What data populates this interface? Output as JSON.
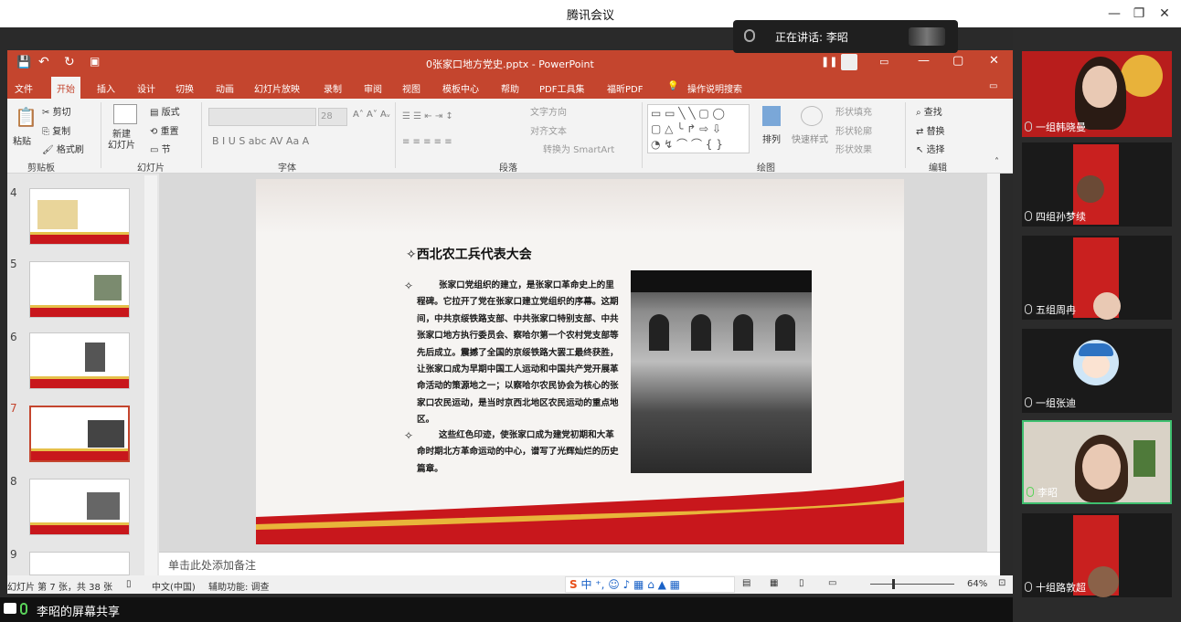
{
  "meeting": {
    "app_title": "腾讯会议",
    "speaking_label": "正在讲话: 李昭",
    "share_status": "李昭的屏幕共享"
  },
  "ppt": {
    "title": "0张家口地方党史.pptx - PowerPoint",
    "tabs": [
      "文件",
      "开始",
      "插入",
      "设计",
      "切换",
      "动画",
      "幻灯片放映",
      "录制",
      "审阅",
      "视图",
      "模板中心",
      "帮助",
      "PDF工具集",
      "福昕PDF"
    ],
    "search": "操作说明搜索",
    "ribbon": {
      "paste": "粘贴",
      "cut": "剪切",
      "copy": "复制",
      "format_painter": "格式刷",
      "new_slide": "新建\n幻灯片",
      "layout": "版式",
      "reset": "重置",
      "section": "节",
      "font_size": "28",
      "text_direction": "文字方向",
      "align_text": "对齐文本",
      "smartart": "转换为 SmartArt",
      "arrange": "排列",
      "quick_styles": "快速样式",
      "shape_fill": "形状填充",
      "shape_outline": "形状轮廓",
      "shape_effects": "形状效果",
      "find": "查找",
      "replace": "替换",
      "select": "选择",
      "groups": [
        "剪贴板",
        "幻灯片",
        "字体",
        "段落",
        "绘图",
        "编辑"
      ]
    },
    "thumbnails": [
      "4",
      "5",
      "6",
      "7",
      "8",
      "9"
    ],
    "selected_slide": "7",
    "slide": {
      "title": "✧西北农工兵代表大会",
      "bullet": "✧",
      "para1": "张家口党组织的建立，是张家口革命史上的里程碑。它拉开了党在张家口建立党组织的序幕。这期间，中共京绥铁路支部、中共张家口特别支部、中共张家口地方执行委员会、察哈尔第一个农村党支部等先后成立。震撼了全国的京绥铁路大罢工最终获胜，让张家口成为早期中国工人运动和中国共产党开展革命活动的策源地之一；以察哈尔农民协会为核心的张家口农民运动，是当时京西北地区农民运动的重点地区。",
      "para2": "这些红色印迹，使张家口成为建党初期和大革命时期北方革命运动的中心，谱写了光辉灿烂的历史篇章。"
    },
    "notes_placeholder": "单击此处添加备注",
    "status": {
      "slide_count": "幻灯片 第 7 张，共 38 张",
      "language": "中文(中国)",
      "accessibility": "辅助功能: 调查",
      "zoom": "64%"
    }
  },
  "participants": [
    {
      "name": "一组韩晓曼",
      "muted": true
    },
    {
      "name": "四组孙梦续",
      "muted": true
    },
    {
      "name": "五组周冉",
      "muted": true
    },
    {
      "name": "一组张迪",
      "muted": true
    },
    {
      "name": "李昭",
      "muted": false
    },
    {
      "name": "十组路敦超",
      "muted": true
    }
  ],
  "colors": {
    "ppt_red": "#c4452e",
    "active_speaker": "#3fbf6f"
  }
}
